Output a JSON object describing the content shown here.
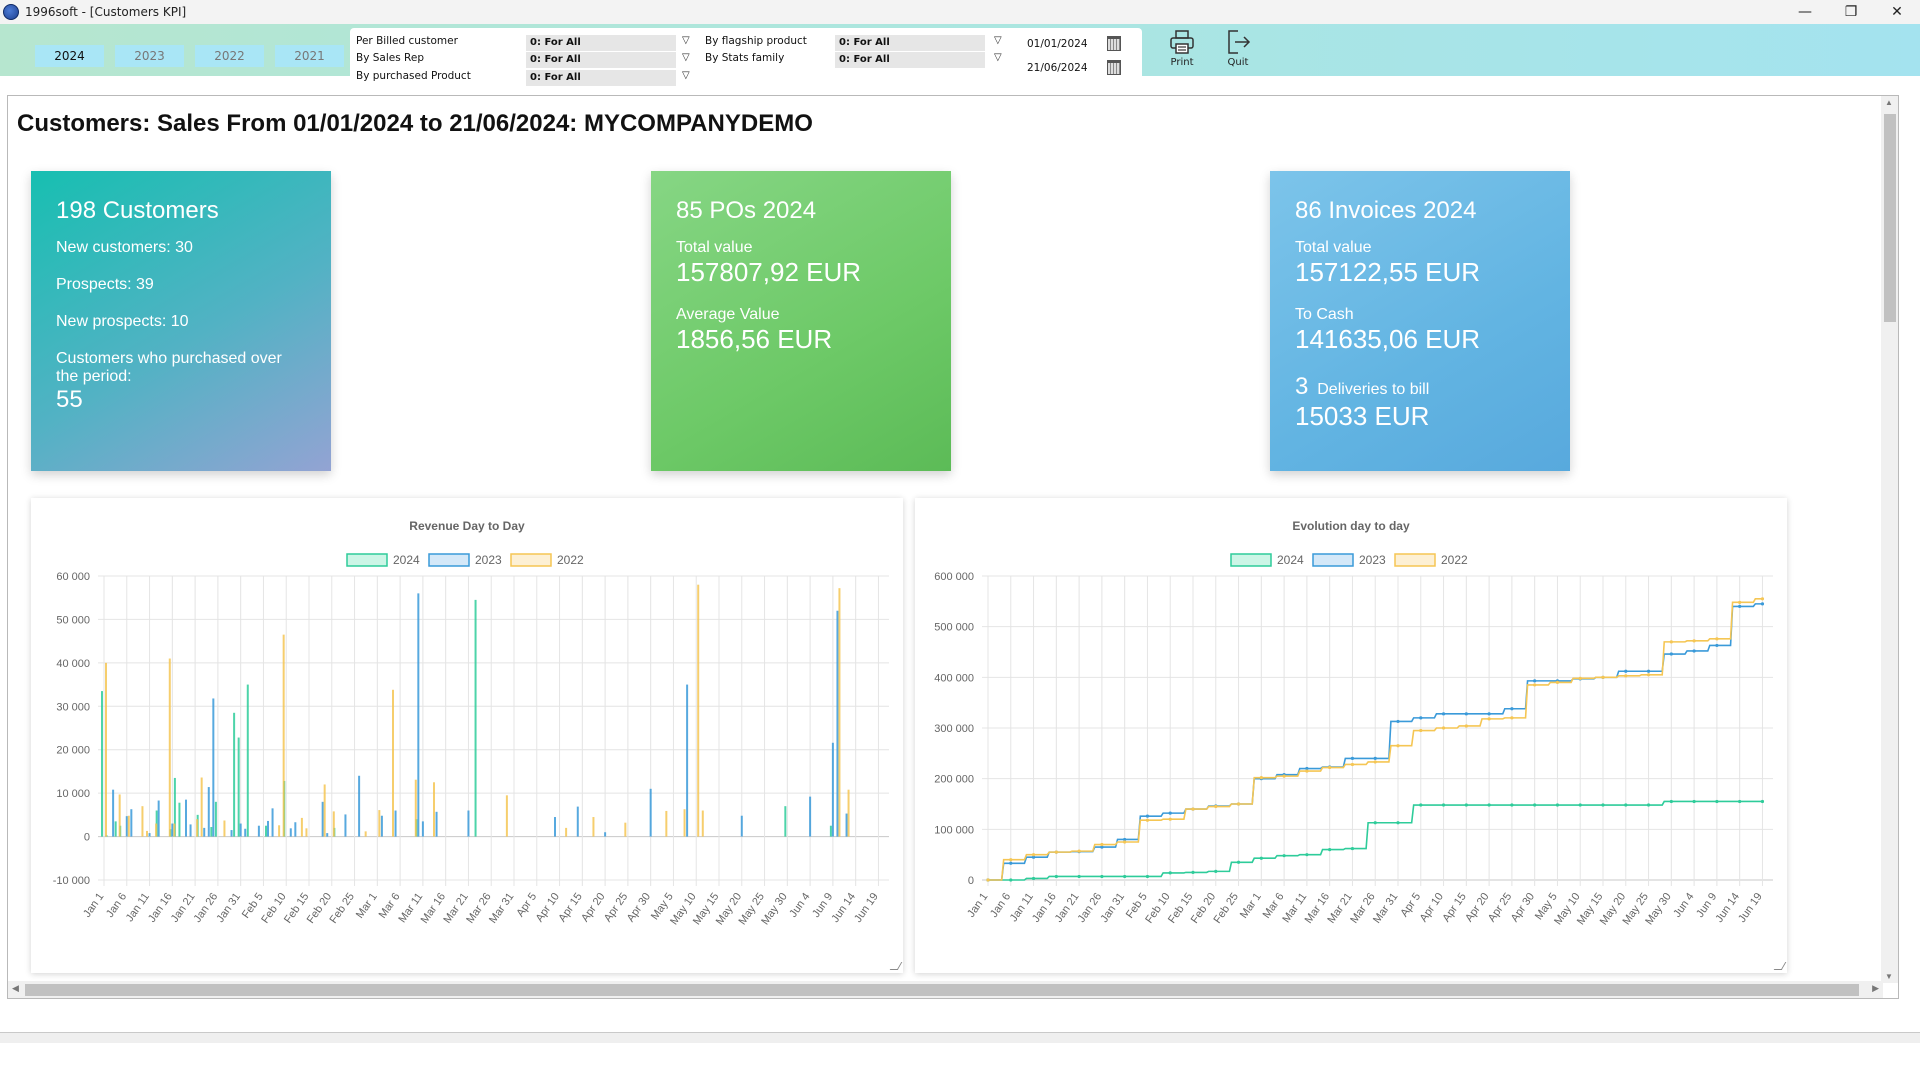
{
  "window": {
    "title": "1996soft - [Customers KPI]",
    "controls": {
      "minimize": "—",
      "maximize": "❐",
      "close": "✕"
    }
  },
  "toolbar": {
    "years": [
      {
        "label": "2024",
        "active": true
      },
      {
        "label": "2023",
        "active": false
      },
      {
        "label": "2022",
        "active": false
      },
      {
        "label": "2021",
        "active": false
      }
    ],
    "filters": [
      {
        "label": "Per Billed customer",
        "value": "0: For All"
      },
      {
        "label": "By Sales Rep",
        "value": "0: For All"
      },
      {
        "label": "By purchased Product",
        "value": "0: For All"
      },
      {
        "label": "By flagship product",
        "value": "0: For All"
      },
      {
        "label": "By Stats family",
        "value": "0: For All"
      }
    ],
    "dropdown_glyph": "▽",
    "date_from": "01/01/2024",
    "date_to": "21/06/2024",
    "print_label": "Print",
    "quit_label": "Quit"
  },
  "page": {
    "title": "Customers: Sales From 01/01/2024 to 21/06/2024: MYCOMPANYDEMO"
  },
  "cards": {
    "customers": {
      "heading": "198  Customers",
      "new_customers": "New customers: 30",
      "prospects": "Prospects: 39",
      "new_prospects": "New prospects:  10",
      "purchased_label": "Customers who purchased over the period:",
      "purchased_value": "55"
    },
    "pos": {
      "heading": "85  POs  2024",
      "total_label": "Total value",
      "total_value": "157807,92  EUR",
      "avg_label": "Average Value",
      "avg_value": "1856,56  EUR"
    },
    "invoices": {
      "heading": "86 Invoices  2024",
      "total_label": "Total value",
      "total_value": "157122,55  EUR",
      "cash_label": "To Cash",
      "cash_value": "141635,06  EUR",
      "deliveries_count": "3",
      "deliveries_label": "Deliveries to bill",
      "deliveries_value": "15033  EUR"
    }
  },
  "chart_data": [
    {
      "type": "bar",
      "title": "Revenue Day to Day",
      "xlabel": "",
      "ylabel": "",
      "ylim": [
        -10000,
        60000
      ],
      "yticks": [
        "60 000",
        "50 000",
        "40 000",
        "30 000",
        "20 000",
        "10 000",
        "0",
        "-10 000"
      ],
      "ytick_values": [
        60000,
        50000,
        40000,
        30000,
        20000,
        10000,
        0,
        -10000
      ],
      "grid": true,
      "legend": "top-center",
      "categories": [
        "Jan 1",
        "Jan 6",
        "Jan 11",
        "Jan 16",
        "Jan 21",
        "Jan 26",
        "Jan 31",
        "Feb 5",
        "Feb 10",
        "Feb 15",
        "Feb 20",
        "Feb 25",
        "Mar 1",
        "Mar 6",
        "Mar 11",
        "Mar 16",
        "Mar 21",
        "Mar 26",
        "Mar 31",
        "Apr 5",
        "Apr 10",
        "Apr 15",
        "Apr 20",
        "Apr 25",
        "Apr 30",
        "May 5",
        "May 10",
        "May 15",
        "May 20",
        "May 25",
        "May 30",
        "Jun 4",
        "Jun 9",
        "Jun 14",
        "Jun 19"
      ],
      "series": [
        {
          "name": "2024",
          "color": "#2ecc9a",
          "fill": "#ccf5e6",
          "points": [
            [
              0,
              33500
            ],
            [
              1,
              300
            ],
            [
              3,
              3500
            ],
            [
              4,
              2500
            ],
            [
              12,
              6000
            ],
            [
              15,
              1700
            ],
            [
              16,
              13500
            ],
            [
              17,
              7800
            ],
            [
              21,
              5000
            ],
            [
              24,
              2200
            ],
            [
              25,
              8000
            ],
            [
              29,
              28500
            ],
            [
              30,
              22800
            ],
            [
              32,
              35000
            ],
            [
              36,
              2500
            ],
            [
              40,
              12800
            ],
            [
              51,
              2000
            ],
            [
              69,
              4000
            ],
            [
              82,
              54500
            ],
            [
              150,
              7000
            ],
            [
              160,
              2500
            ]
          ]
        },
        {
          "name": "2023",
          "color": "#3a9ad9",
          "fill": "#d4e8f8",
          "points": [
            [
              2,
              10800
            ],
            [
              5,
              4700
            ],
            [
              6,
              6300
            ],
            [
              10,
              800
            ],
            [
              12,
              8300
            ],
            [
              15,
              3000
            ],
            [
              18,
              8500
            ],
            [
              19,
              2800
            ],
            [
              22,
              2000
            ],
            [
              23,
              11400
            ],
            [
              24,
              31800
            ],
            [
              28,
              1500
            ],
            [
              30,
              3000
            ],
            [
              31,
              1800
            ],
            [
              34,
              2500
            ],
            [
              36,
              3600
            ],
            [
              37,
              6500
            ],
            [
              41,
              1900
            ],
            [
              42,
              3300
            ],
            [
              48,
              8000
            ],
            [
              49,
              800
            ],
            [
              53,
              5100
            ],
            [
              56,
              14000
            ],
            [
              61,
              4800
            ],
            [
              64,
              6000
            ],
            [
              69,
              56000
            ],
            [
              70,
              3500
            ],
            [
              73,
              5700
            ],
            [
              80,
              6000
            ],
            [
              99,
              4500
            ],
            [
              104,
              6900
            ],
            [
              110,
              1000
            ],
            [
              120,
              11000
            ],
            [
              128,
              35000
            ],
            [
              140,
              4800
            ],
            [
              155,
              9200
            ],
            [
              160,
              21600
            ],
            [
              161,
              52000
            ],
            [
              163,
              5300
            ]
          ]
        },
        {
          "name": "2022",
          "color": "#f5c654",
          "fill": "#fdf0d4",
          "points": [
            [
              0,
              40000
            ],
            [
              3,
              9700
            ],
            [
              5,
              4800
            ],
            [
              8,
              7000
            ],
            [
              9,
              1300
            ],
            [
              11,
              3000
            ],
            [
              14,
              41000
            ],
            [
              15,
              3000
            ],
            [
              20,
              4000
            ],
            [
              21,
              13600
            ],
            [
              26,
              3700
            ],
            [
              38,
              2600
            ],
            [
              39,
              46500
            ],
            [
              43,
              4300
            ],
            [
              44,
              1900
            ],
            [
              48,
              12000
            ],
            [
              50,
              5800
            ],
            [
              57,
              1200
            ],
            [
              60,
              6100
            ],
            [
              63,
              33800
            ],
            [
              68,
              13100
            ],
            [
              72,
              12500
            ],
            [
              88,
              9500
            ],
            [
              101,
              2000
            ],
            [
              107,
              4500
            ],
            [
              114,
              3200
            ],
            [
              123,
              5900
            ],
            [
              127,
              6300
            ],
            [
              130,
              58000
            ],
            [
              131,
              6000
            ],
            [
              161,
              57200
            ],
            [
              163,
              10800
            ]
          ]
        }
      ]
    },
    {
      "type": "line",
      "title": "Evolution day to day",
      "xlabel": "",
      "ylabel": "",
      "ylim": [
        0,
        600000
      ],
      "yticks": [
        "600 000",
        "500 000",
        "400 000",
        "300 000",
        "200 000",
        "100 000",
        "0"
      ],
      "ytick_values": [
        600000,
        500000,
        400000,
        300000,
        200000,
        100000,
        0
      ],
      "grid": true,
      "legend": "top-center",
      "categories": [
        "Jan 1",
        "Jan 6",
        "Jan 11",
        "Jan 16",
        "Jan 21",
        "Jan 26",
        "Jan 31",
        "Feb 5",
        "Feb 10",
        "Feb 15",
        "Feb 20",
        "Feb 25",
        "Mar 1",
        "Mar 6",
        "Mar 11",
        "Mar 16",
        "Mar 21",
        "Mar 26",
        "Mar 31",
        "Apr 5",
        "Apr 10",
        "Apr 15",
        "Apr 20",
        "Apr 25",
        "Apr 30",
        "May 5",
        "May 10",
        "May 15",
        "May 20",
        "May 25",
        "May 30",
        "Jun 4",
        "Jun 9",
        "Jun 14",
        "Jun 19"
      ],
      "series": [
        {
          "name": "2024",
          "color": "#2ecc9a",
          "fill": "#ccf5e6",
          "values": [
            0,
            0,
            3000,
            7000,
            7000,
            7000,
            7000,
            7000,
            14000,
            15000,
            17000,
            35000,
            43000,
            48000,
            50000,
            60000,
            62000,
            113000,
            113000,
            148000,
            148000,
            148000,
            148000,
            148000,
            148000,
            148000,
            148000,
            148000,
            148000,
            148000,
            155000,
            155000,
            155000,
            155000,
            155000
          ]
        },
        {
          "name": "2023",
          "color": "#3a9ad9",
          "fill": "#d4e8f8",
          "values": [
            0,
            33000,
            45000,
            55000,
            56000,
            65000,
            80000,
            126000,
            132000,
            140000,
            146000,
            150000,
            200000,
            208000,
            220000,
            223000,
            240000,
            240000,
            313000,
            320000,
            328000,
            328000,
            328000,
            338000,
            393000,
            393000,
            397000,
            400000,
            412000,
            412000,
            446000,
            452000,
            463000,
            540000,
            545000
          ]
        },
        {
          "name": "2022",
          "color": "#f5c654",
          "fill": "#fdf0d4",
          "values": [
            0,
            40000,
            50000,
            55000,
            57000,
            70000,
            75000,
            118000,
            120000,
            140000,
            145000,
            150000,
            202000,
            205000,
            215000,
            222000,
            228000,
            233000,
            265000,
            295000,
            300000,
            304000,
            318000,
            320000,
            385000,
            390000,
            398000,
            400000,
            403000,
            405000,
            470000,
            472000,
            476000,
            548000,
            555000
          ]
        }
      ]
    }
  ]
}
